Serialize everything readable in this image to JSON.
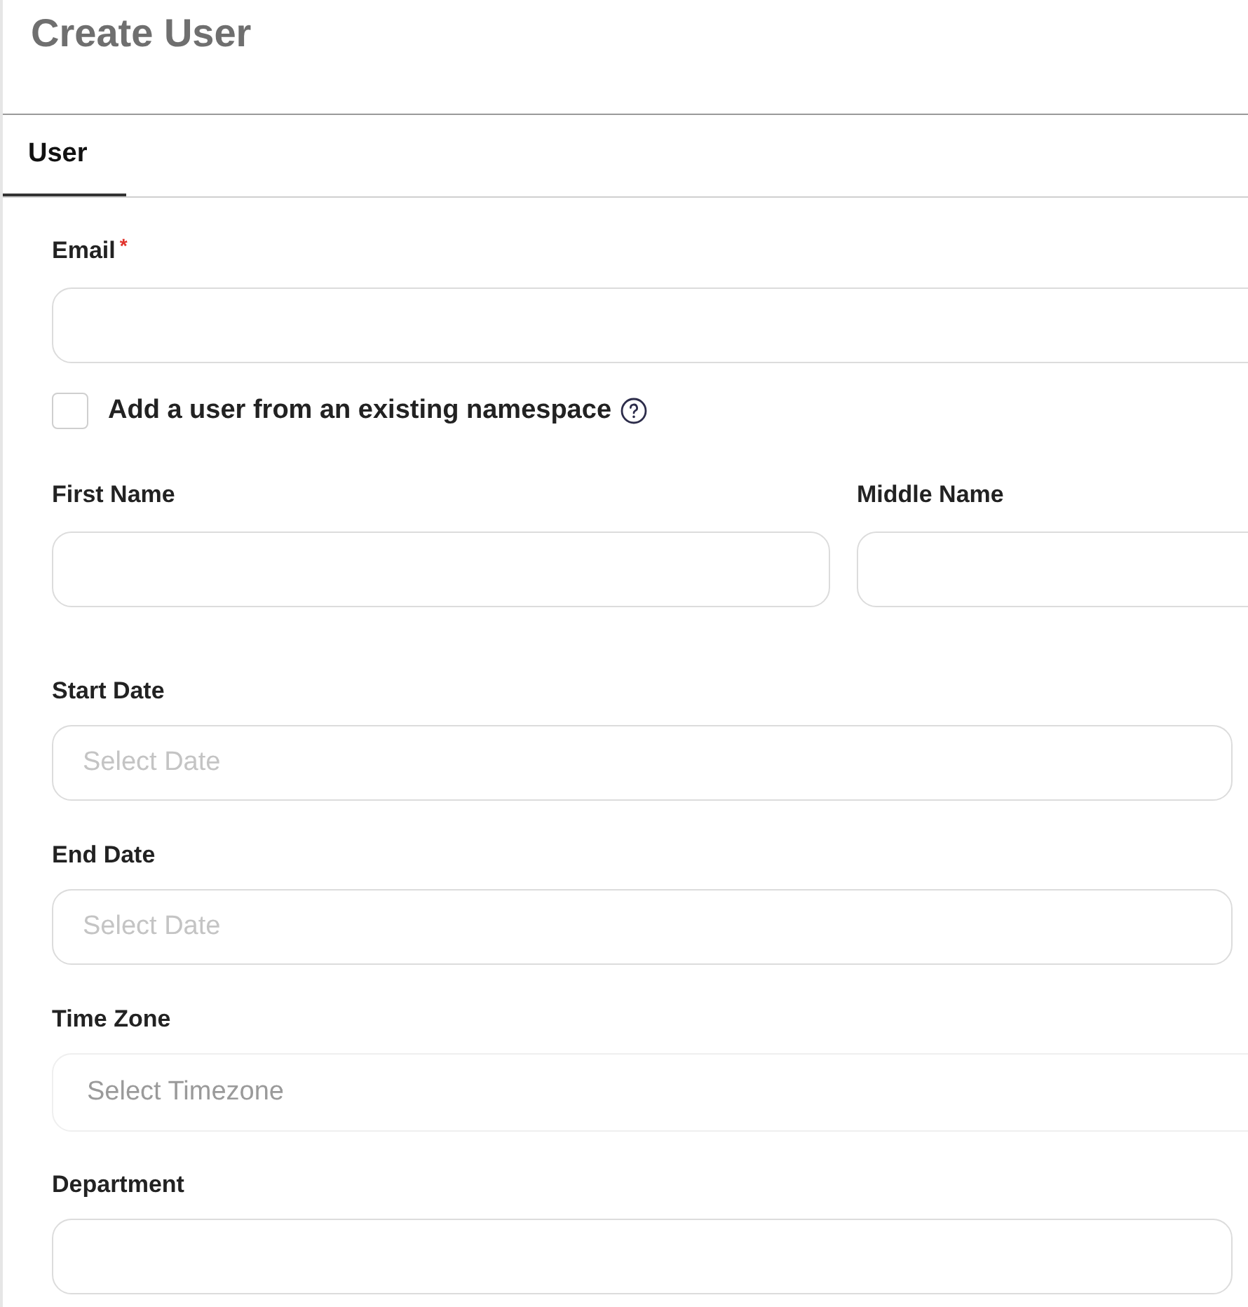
{
  "title": "Create User",
  "tabs": [
    {
      "label": "User",
      "selected": true
    }
  ],
  "email": {
    "label": "Email",
    "required_mark": "*"
  },
  "existing_namespace": {
    "label": "Add a user from an existing namespace",
    "checked": false
  },
  "first_name": {
    "label": "First Name"
  },
  "middle_name": {
    "label": "Middle Name"
  },
  "start_date": {
    "label": "Start Date",
    "placeholder": "Select Date"
  },
  "end_date": {
    "label": "End Date",
    "placeholder": "Select Date"
  },
  "time_zone": {
    "label": "Time Zone",
    "placeholder": "Select Timezone"
  },
  "department": {
    "label": "Department"
  }
}
